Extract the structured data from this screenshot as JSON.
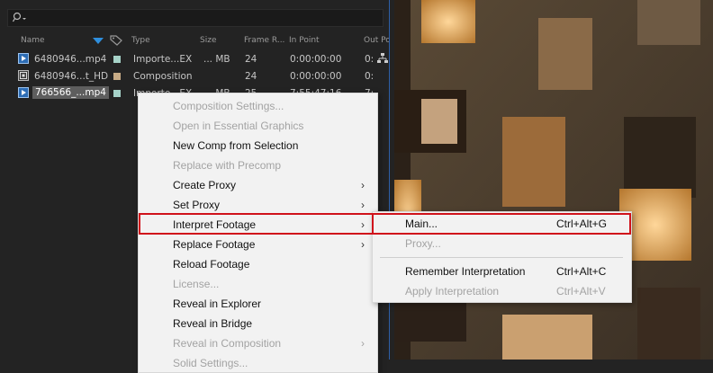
{
  "columns": [
    "Name",
    "Type",
    "Size",
    "Frame R...",
    "In Point",
    "Out Poi"
  ],
  "rows": [
    {
      "name": "6480946...mp4",
      "type": "Importe...EX",
      "size": "... MB",
      "frame_rate": "24",
      "in_point": "0:00:00:00",
      "out_point": "0:",
      "swatch": "#a6d2c8"
    },
    {
      "name": "6480946...t_HD",
      "type": "Composition",
      "size": "",
      "frame_rate": "24",
      "in_point": "0:00:00:00",
      "out_point": "0:",
      "swatch": "#c8ab86"
    },
    {
      "name": "766566_...mp4",
      "type": "Importe...EX",
      "size": "... MB",
      "frame_rate": "25",
      "in_point": "7:55:47:16",
      "out_point": "7:",
      "swatch": "#a6d2c8"
    }
  ],
  "context_menu": {
    "items": [
      {
        "label": "Composition Settings...",
        "disabled": true
      },
      {
        "label": "Open in Essential Graphics",
        "disabled": true
      },
      {
        "label": "New Comp from Selection",
        "disabled": false
      },
      {
        "label": "Replace with Precomp",
        "disabled": true
      },
      {
        "label": "Create Proxy",
        "disabled": false,
        "submenu": true
      },
      {
        "label": "Set Proxy",
        "disabled": false,
        "submenu": true
      },
      {
        "label": "Interpret Footage",
        "disabled": false,
        "submenu": true
      },
      {
        "label": "Replace Footage",
        "disabled": false,
        "submenu": true
      },
      {
        "label": "Reload Footage",
        "disabled": false
      },
      {
        "label": "License...",
        "disabled": true
      },
      {
        "label": "Reveal in Explorer",
        "disabled": false
      },
      {
        "label": "Reveal in Bridge",
        "disabled": false
      },
      {
        "label": "Reveal in Composition",
        "disabled": true,
        "submenu": true
      },
      {
        "label": "Solid Settings...",
        "disabled": true
      }
    ]
  },
  "submenu": {
    "items": [
      {
        "label": "Main...",
        "shortcut": "Ctrl+Alt+G",
        "disabled": false
      },
      {
        "label": "Proxy...",
        "shortcut": "",
        "disabled": true
      },
      {
        "label": "Remember Interpretation",
        "shortcut": "Ctrl+Alt+C",
        "disabled": false
      },
      {
        "label": "Apply Interpretation",
        "shortcut": "Ctrl+Alt+V",
        "disabled": true
      }
    ]
  },
  "colors": {
    "highlight": "#d0121b",
    "panel_bg": "#232323",
    "menu_bg": "#f2f2f2"
  }
}
